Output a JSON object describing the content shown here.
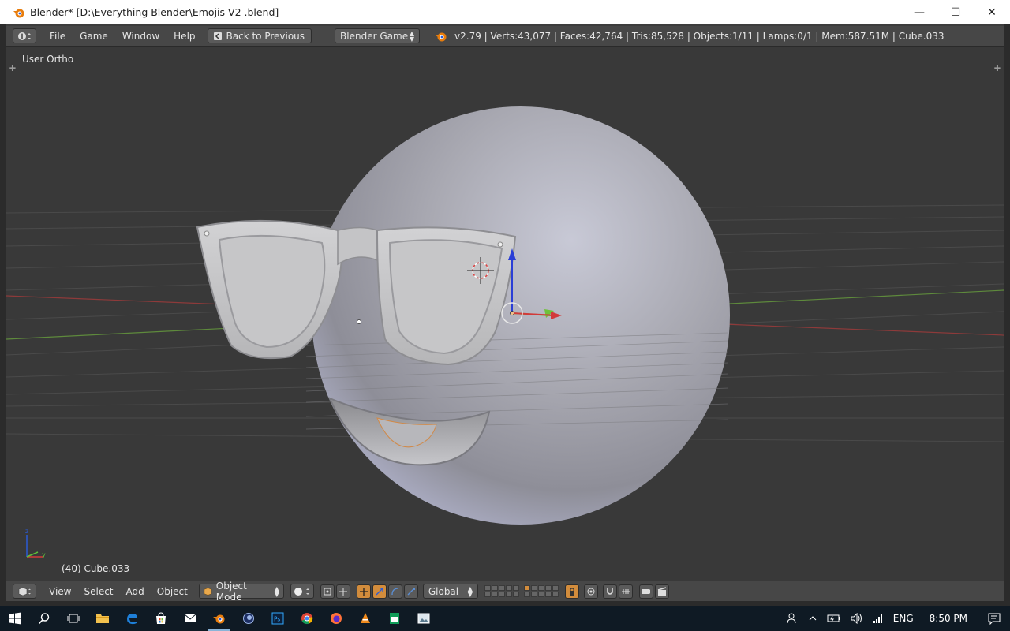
{
  "window": {
    "title": "Blender* [D:\\Everything Blender\\Emojis V2 .blend]",
    "minimize": "—",
    "maximize": "☐",
    "close": "✕"
  },
  "info_header": {
    "menus": [
      "File",
      "Game",
      "Window",
      "Help"
    ],
    "back_button": "Back to Previous",
    "engine": "Blender Game",
    "stats": "v2.79 | Verts:43,077 | Faces:42,764 | Tris:85,528 | Objects:1/11 | Lamps:0/1 | Mem:587.51M | Cube.033"
  },
  "viewport": {
    "view_name": "User Ortho",
    "active_object": "(40) Cube.033"
  },
  "view_header": {
    "menus": [
      "View",
      "Select",
      "Add",
      "Object"
    ],
    "mode": "Object Mode",
    "orientation": "Global"
  },
  "taskbar": {
    "apps": [
      "start-icon",
      "search-icon",
      "task-view-icon",
      "file-explorer-icon",
      "edge-icon",
      "store-icon",
      "mail-icon",
      "blender-icon",
      "cinema4d-icon",
      "photoshop-icon",
      "chrome-icon",
      "firefox-icon",
      "vlc-icon",
      "sheets-icon",
      "photos-icon"
    ],
    "language": "ENG",
    "time": "8:50 PM"
  },
  "colors": {
    "blender_orange": "#e87d0d",
    "axis_x": "#d43b3b",
    "axis_y": "#5fbf3a",
    "axis_z": "#2a5bd6"
  }
}
